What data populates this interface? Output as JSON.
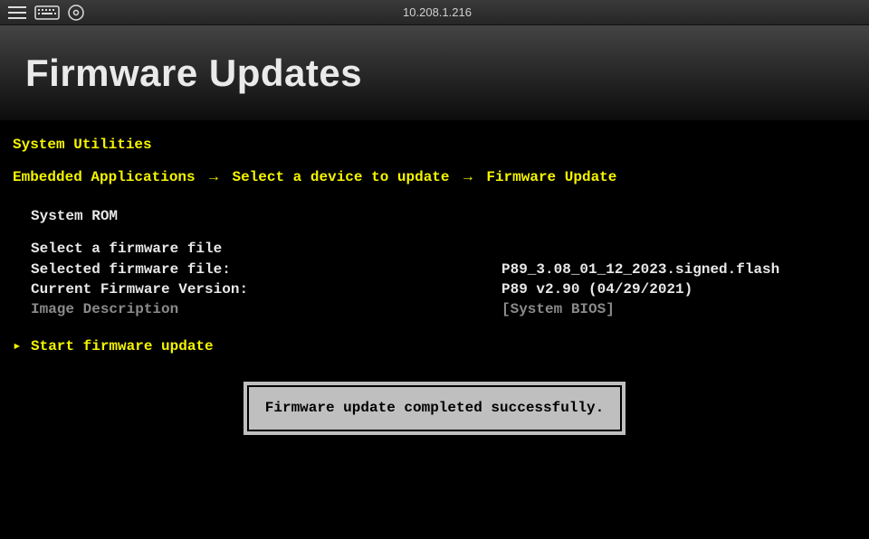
{
  "topbar": {
    "ip": "10.208.1.216"
  },
  "banner": {
    "title": "Firmware Updates"
  },
  "console": {
    "section_title": "System Utilities",
    "breadcrumb": {
      "a": "Embedded Applications",
      "b": "Select a device to update",
      "c": "Firmware Update"
    },
    "device": "System ROM",
    "select_prompt": "Select a firmware file",
    "selected_label": "Selected firmware file:",
    "selected_value": "P89_3.08_01_12_2023.signed.flash",
    "current_label": "Current Firmware Version:",
    "current_value": "P89 v2.90 (04/29/2021)",
    "imgdesc_label": "Image Description",
    "imgdesc_value": "[System BIOS]",
    "action": "Start firmware update"
  },
  "dialog": {
    "message": "Firmware update completed successfully."
  }
}
